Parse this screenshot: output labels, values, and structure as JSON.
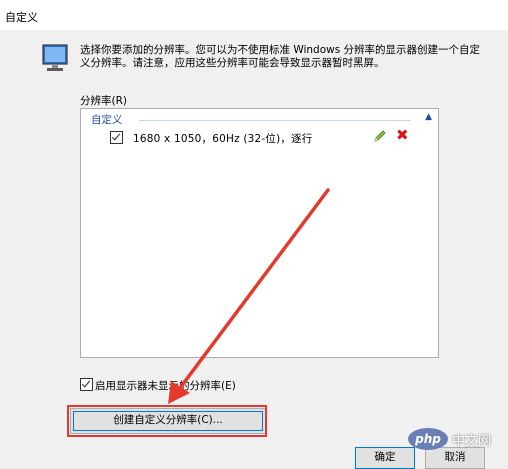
{
  "window": {
    "title": "自定义"
  },
  "description": "选择你要添加的分辨率。您可以为不使用标准 Windows 分辨率的显示器创建一个自定义分辨率。请注意，应用这些分辨率可能会导致显示器暂时黑屏。",
  "resolution_list": {
    "label": "分辨率(R)",
    "group_label": "自定义",
    "collapse_icon": "chevron-up-icon",
    "items": [
      {
        "text": "1680 x 1050，60Hz (32-位)，逐行",
        "checked": true
      }
    ]
  },
  "enable_unsupported": {
    "label": "启用显示器未显示的分辨率(E)",
    "checked": true
  },
  "create_button": {
    "label": "创建自定义分辨率(C)..."
  },
  "ok_button": {
    "label": "确定"
  },
  "cancel_button": {
    "label": "取消"
  },
  "watermark": {
    "logo": "php",
    "text": "中文网"
  },
  "colors": {
    "highlight": "#e5392e",
    "link_blue": "#1e4fa6",
    "delete_red": "#d3171d"
  }
}
